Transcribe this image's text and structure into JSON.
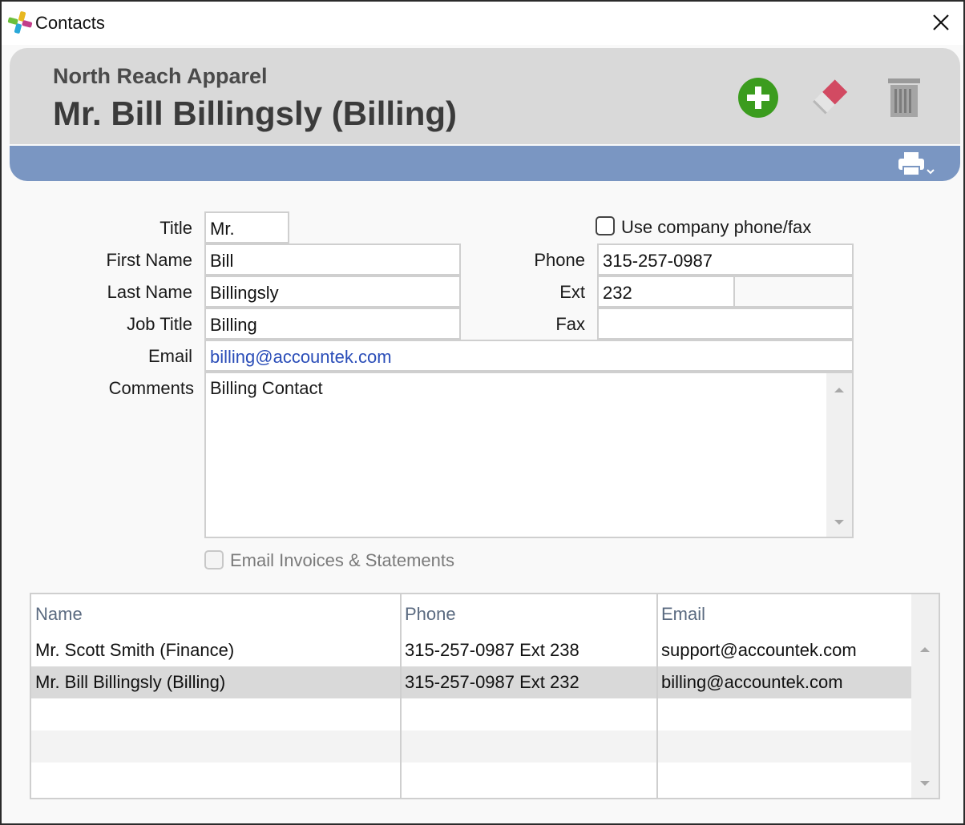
{
  "window": {
    "title": "Contacts"
  },
  "header": {
    "company": "North Reach Apparel",
    "contact_name": "Mr. Bill Billingsly (Billing)"
  },
  "icons": {
    "app": "app-logo-icon",
    "close": "close-icon",
    "add": "plus-circle-icon",
    "clear": "eraser-icon",
    "delete": "trash-icon",
    "print": "printer-icon",
    "print_dropdown": "chevron-down-icon"
  },
  "colors": {
    "header_bg": "#d9d9d9",
    "band": "#7a96c2",
    "add_green": "#3b9c1e",
    "eraser_red": "#d24a62",
    "link": "#2a4db8"
  },
  "form": {
    "labels": {
      "title": "Title",
      "first_name": "First Name",
      "last_name": "Last Name",
      "job_title": "Job Title",
      "email": "Email",
      "comments": "Comments",
      "phone": "Phone",
      "ext": "Ext",
      "fax": "Fax"
    },
    "values": {
      "title": "Mr.",
      "first_name": "Bill",
      "last_name": "Billingsly",
      "job_title": "Billing",
      "email": "billing@accountek.com",
      "comments": "Billing Contact",
      "phone": "315-257-0987",
      "ext": "232",
      "fax": ""
    },
    "use_company_phone_label": "Use company phone/fax",
    "use_company_phone_checked": false,
    "email_invoices_label": "Email Invoices & Statements",
    "email_invoices_checked": false
  },
  "grid": {
    "columns": [
      "Name",
      "Phone",
      "Email"
    ],
    "rows": [
      {
        "name": "Mr. Scott Smith (Finance)",
        "phone": "315-257-0987 Ext 238",
        "email": "support@accountek.com",
        "selected": false
      },
      {
        "name": "Mr. Bill Billingsly (Billing)",
        "phone": "315-257-0987 Ext 232",
        "email": "billing@accountek.com",
        "selected": true
      }
    ]
  }
}
